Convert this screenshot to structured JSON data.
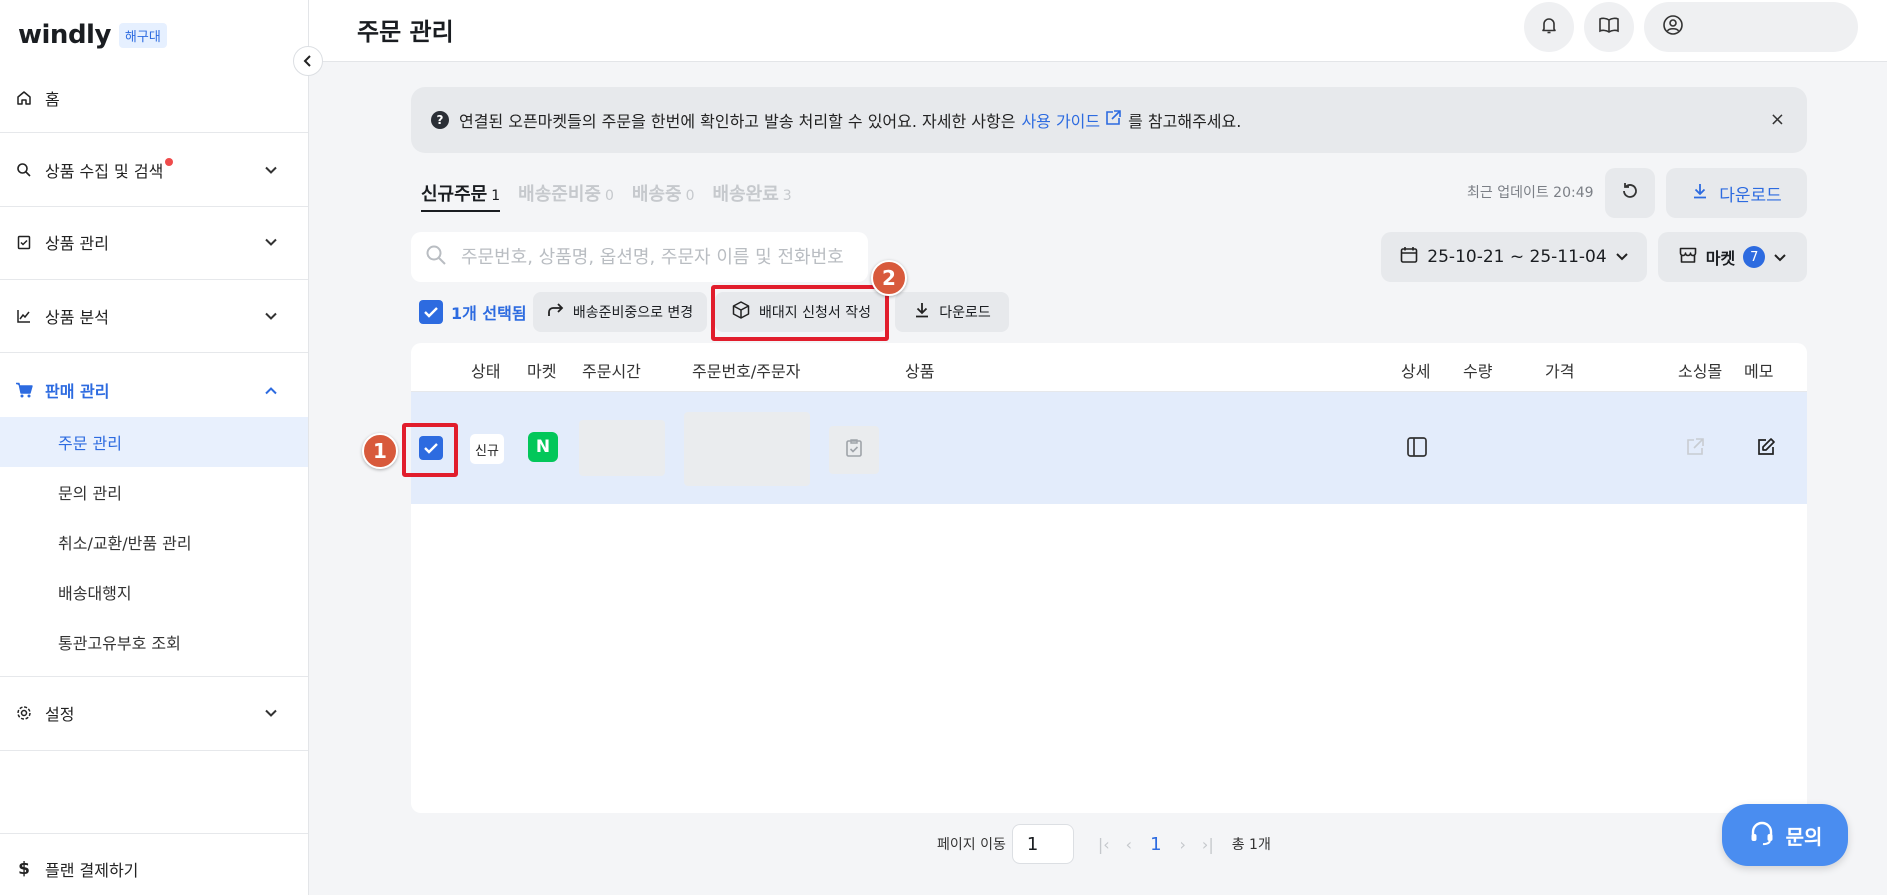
{
  "sidebar": {
    "logo": "windly",
    "badge": "해구대",
    "items": [
      {
        "label": "홈"
      },
      {
        "label": "상품 수집 및 검색"
      },
      {
        "label": "상품 관리"
      },
      {
        "label": "상품 분석"
      },
      {
        "label": "판매 관리"
      }
    ],
    "sub_items": [
      {
        "label": "주문 관리"
      },
      {
        "label": "문의 관리"
      },
      {
        "label": "취소/교환/반품 관리"
      },
      {
        "label": "배송대행지"
      },
      {
        "label": "통관고유부호 조회"
      }
    ],
    "settings": "설정",
    "billing": "플랜 결제하기"
  },
  "header": {
    "title": "주문 관리"
  },
  "banner": {
    "text_before": "연결된 오픈마켓들의 주문을 한번에 확인하고 발송 처리할 수 있어요. 자세한 사항은",
    "link": "사용 가이드",
    "text_after": "를 참고해주세요.",
    "close": "×"
  },
  "tabs": [
    {
      "label": "신규주문",
      "count": "1"
    },
    {
      "label": "배송준비중",
      "count": "0"
    },
    {
      "label": "배송중",
      "count": "0"
    },
    {
      "label": "배송완료",
      "count": "3"
    }
  ],
  "update_text": "최근 업데이트 20:49",
  "download_label": "다운로드",
  "search": {
    "placeholder": "주문번호, 상품명, 옵션명, 주문자 이름 및 전화번호"
  },
  "date_range": "25-10-21 ~ 25-11-04",
  "market": {
    "label": "마켓",
    "count": "7"
  },
  "toolbar": {
    "selected": "1개 선택됨",
    "change_status": "배송준비중으로 변경",
    "create_form": "배대지 신청서 작성",
    "download": "다운로드"
  },
  "table": {
    "headers": [
      "상태",
      "마켓",
      "주문시간",
      "주문번호/주문자",
      "상품",
      "상세",
      "수량",
      "가격",
      "소싱몰",
      "메모"
    ],
    "row": {
      "status": "신규",
      "market_logo": "N"
    }
  },
  "pagination": {
    "move_label": "페이지 이동",
    "input_value": "1",
    "current": "1",
    "total": "총 1개"
  },
  "help_button": "문의",
  "markers": [
    "1",
    "2"
  ],
  "colors": {
    "accent": "#2d6be0",
    "highlight": "#e11d2c",
    "naver": "#03c75a"
  }
}
